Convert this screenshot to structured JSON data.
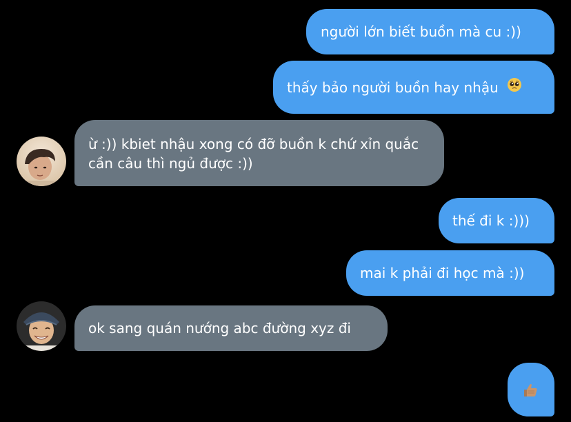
{
  "conversation": {
    "messages": [
      {
        "direction": "sent",
        "text": "người lớn biết buồn mà cu :))"
      },
      {
        "direction": "sent",
        "text": "thấy bảo người buồn hay nhậu",
        "emoji": "pleading-face"
      },
      {
        "direction": "received",
        "text": "ừ :)) kbiet nhậu xong có đỡ buồn k chứ xỉn quắc cần câu thì ngủ được :))"
      },
      {
        "direction": "sent",
        "text": "thế đi k :)))"
      },
      {
        "direction": "sent",
        "text": "mai k phải đi học mà :))"
      },
      {
        "direction": "received",
        "text": "ok sang quán nướng abc đường xyz đi"
      },
      {
        "direction": "sent",
        "emoji": "thumbs-up"
      }
    ]
  },
  "colors": {
    "background": "#000000",
    "sent_bubble": "#4a9ff0",
    "received_bubble": "#697681",
    "text": "#ffffff"
  }
}
